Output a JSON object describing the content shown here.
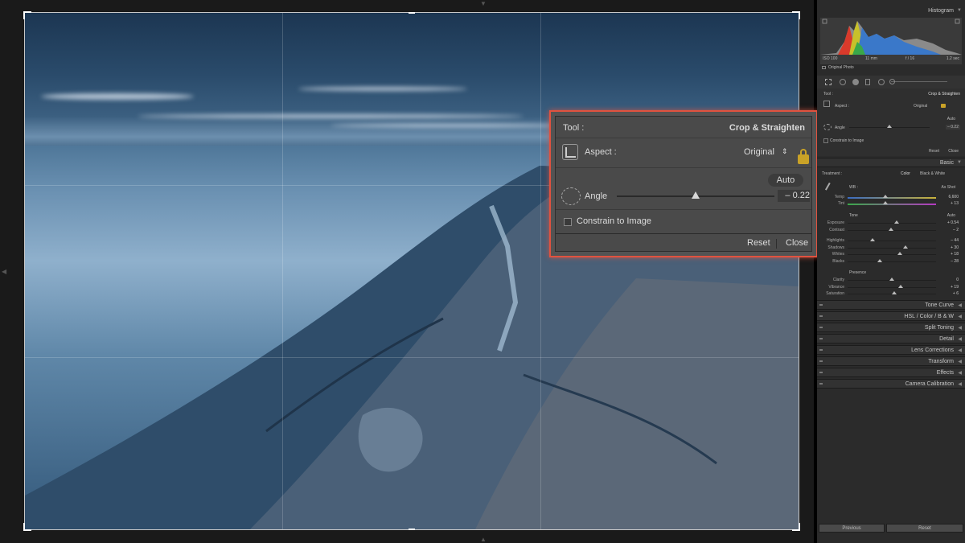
{
  "photo": {
    "description_icon": "seascape-photo"
  },
  "callout": {
    "tool_label": "Tool :",
    "tool_value": "Crop & Straighten",
    "aspect_label": "Aspect :",
    "aspect_value": "Original",
    "aspect_arrows": "⇕",
    "auto_button": "Auto",
    "angle_label": "Angle",
    "angle_value": "– 0.22",
    "angle_fraction": 0.5,
    "constrain_label": "Constrain to Image",
    "reset_button": "Reset",
    "close_button": "Close"
  },
  "panel": {
    "histogram_title": "Histogram",
    "hist_iso": "ISO 100",
    "hist_focal": "11 mm",
    "hist_aperture": "f / 16",
    "hist_shutter": "1.2 sec",
    "original_photo": "Original Photo",
    "tool_label": "Tool :",
    "tool_value": "Crop & Straighten",
    "aspect_label": "Aspect :",
    "aspect_value": "Original",
    "auto": "Auto",
    "angle_label": "Angle",
    "angle_value": "– 0.22",
    "constrain_label": "Constrain to Image",
    "reset": "Reset",
    "close": "Close",
    "basic_title": "Basic",
    "treatment_label": "Treatment :",
    "treatment_color": "Color",
    "treatment_bw": "Black & White",
    "wb_label": "WB :",
    "wb_value": "As Shot",
    "temp_label": "Temp",
    "temp_value": "6,600",
    "tint_label": "Tint",
    "tint_value": "+ 13",
    "tone_label": "Tone",
    "tone_auto": "Auto",
    "sliders": [
      {
        "label": "Exposure",
        "value": "+ 0.54",
        "pos": 0.55
      },
      {
        "label": "Contrast",
        "value": "– 2",
        "pos": 0.49
      },
      {
        "label": "Highlights",
        "value": "– 44",
        "pos": 0.28
      },
      {
        "label": "Shadows",
        "value": "+ 30",
        "pos": 0.65
      },
      {
        "label": "Whites",
        "value": "+ 18",
        "pos": 0.59
      },
      {
        "label": "Blacks",
        "value": "– 28",
        "pos": 0.36
      }
    ],
    "presence_label": "Presence",
    "presence_sliders": [
      {
        "label": "Clarity",
        "value": "0",
        "pos": 0.5
      },
      {
        "label": "Vibrance",
        "value": "+ 19",
        "pos": 0.6
      },
      {
        "label": "Saturation",
        "value": "+ 6",
        "pos": 0.53
      }
    ],
    "sections": [
      "Tone Curve",
      "HSL / Color / B & W",
      "Split Toning",
      "Detail",
      "Lens Corrections",
      "Transform",
      "Effects",
      "Camera Calibration"
    ],
    "previous_button": "Previous",
    "reset_button": "Reset"
  },
  "colors": {
    "accent": "#e0523f",
    "lock": "#c9a227"
  }
}
